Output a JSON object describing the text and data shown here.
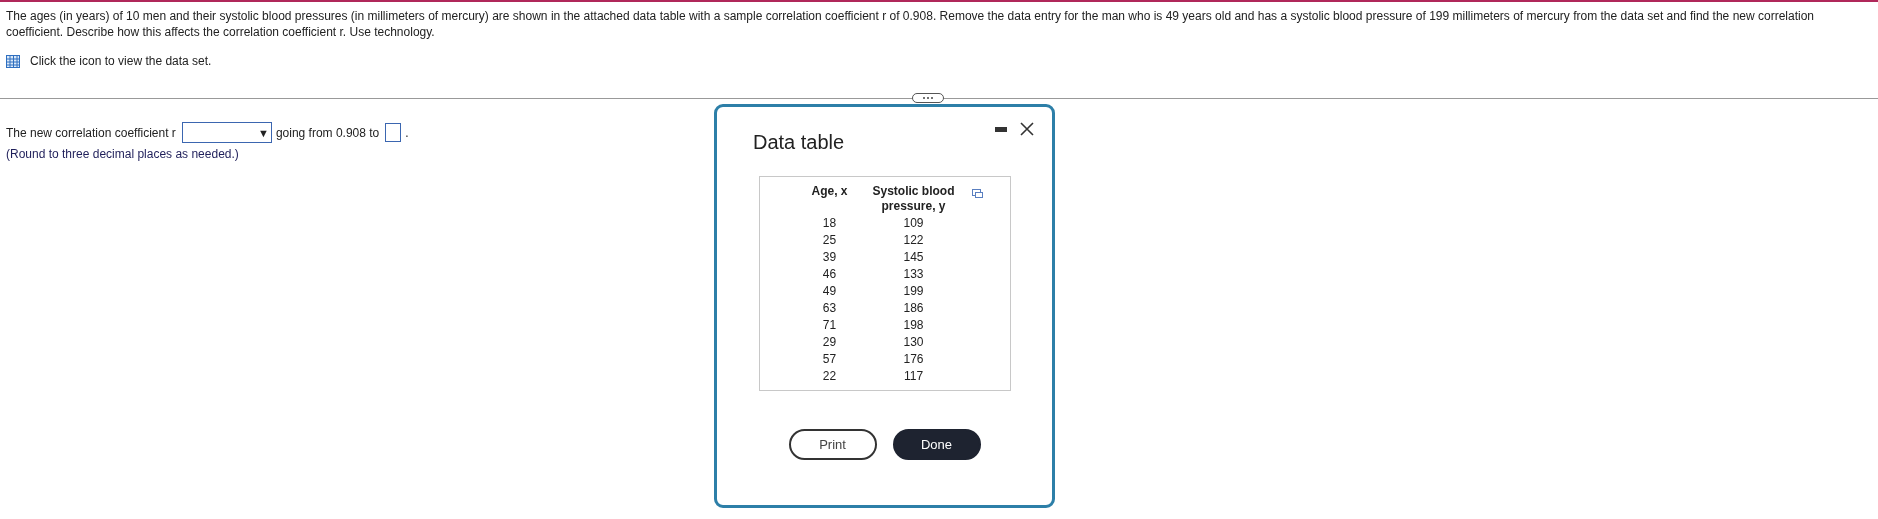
{
  "question": {
    "text": "The ages (in years) of 10 men and their systolic blood pressures (in millimeters of mercury) are shown in the attached data table with a sample correlation coefficient r of 0.908. Remove the data entry for the man who is 49 years old and has a systolic blood pressure of 199 millimeters of mercury from the data set and find the new correlation coefficient. Describe how this affects the correlation coefficient r. Use technology.",
    "data_link": "Click the icon to view the data set."
  },
  "answer": {
    "prefix": "The new correlation coefficient r",
    "dropdown_arrow": "▼",
    "middle": "going from 0.908 to",
    "suffix": ".",
    "note": "(Round to three decimal places as needed.)"
  },
  "dialog": {
    "title": "Data table",
    "columns": [
      "Age, x",
      "Systolic blood pressure, y"
    ],
    "rows": [
      [
        "18",
        "109"
      ],
      [
        "25",
        "122"
      ],
      [
        "39",
        "145"
      ],
      [
        "46",
        "133"
      ],
      [
        "49",
        "199"
      ],
      [
        "63",
        "186"
      ],
      [
        "71",
        "198"
      ],
      [
        "29",
        "130"
      ],
      [
        "57",
        "176"
      ],
      [
        "22",
        "117"
      ]
    ],
    "buttons": [
      {
        "label": "Print",
        "kind": "secondary"
      },
      {
        "label": "Done",
        "kind": "primary"
      }
    ]
  }
}
